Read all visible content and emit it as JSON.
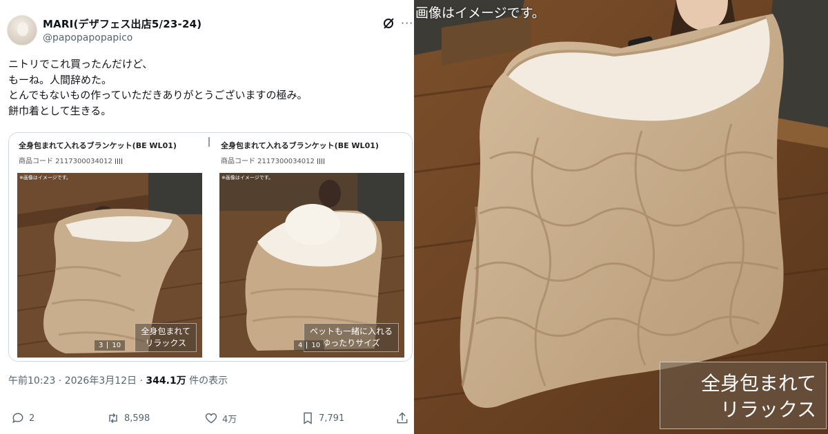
{
  "tweet": {
    "display_name": "MARI(デザフェス出店5/23-24)",
    "handle": "@papopapopapico",
    "lines": [
      "ニトリでこれ買ったんだけど、",
      "もーね。人間辞めた。",
      "とんでもないもの作っていただきありがとうございますの極み。",
      "餅巾着として生きる。"
    ],
    "timestamp": "午前10:23 · 2026年3月12日 · ",
    "views": "344.1万",
    "views_suffix": " 件の表示",
    "actions": {
      "reply": "2",
      "retweet": "8,598",
      "like": "4万",
      "bookmark": "7,791"
    }
  },
  "media": {
    "cards": [
      {
        "title": "全身包まれて入れるブランケット(BE WL01)",
        "code": "商品コード  2117300034012",
        "note": "※画像はイメージです。",
        "caption_lines": [
          "全身包まれて",
          "リラックス"
        ],
        "counter_current": "3",
        "counter_total": "10"
      },
      {
        "title": "全身包まれて入れるブランケット(BE WL01)",
        "code": "商品コード  2117300034012",
        "note": "※画像はイメージです。",
        "caption_lines": [
          "ペットも一緒に入れる",
          "ゆったりサイズ"
        ],
        "counter_current": "4",
        "counter_total": "10"
      }
    ]
  },
  "hero": {
    "note": "画像はイメージです。",
    "caption_lines": [
      "全身包まれて",
      "リラックス"
    ]
  },
  "icons": {
    "grok": "grok-icon",
    "more": "more-icon",
    "reply": "reply-icon",
    "retweet": "retweet-icon",
    "like": "heart-icon",
    "bookmark": "bookmark-icon",
    "share": "share-icon"
  },
  "colors": {
    "text": "#0f1419",
    "muted": "#536471",
    "border": "#cfd9de",
    "blanket": "#c8ad8c",
    "floor": "#6a4324"
  }
}
